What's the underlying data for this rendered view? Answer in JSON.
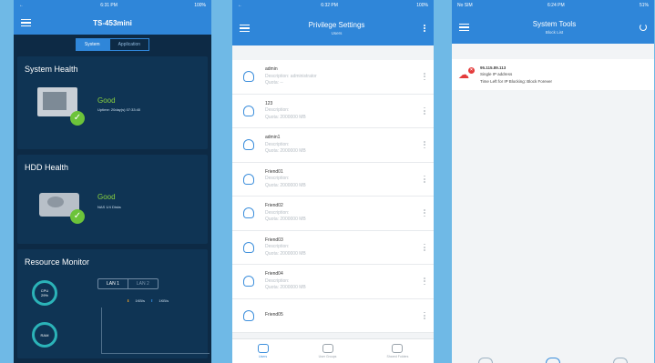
{
  "phone1": {
    "status": {
      "carrier": "",
      "time": "6:31 PM",
      "battery": "100%"
    },
    "title": "TS-453mini",
    "segments": [
      "System",
      "Application"
    ],
    "system_health": {
      "heading": "System Health",
      "status": "Good",
      "uptime": "Uptime: 20day(s) 07:33:40"
    },
    "hdd_health": {
      "heading": "HDD Health",
      "status": "Good",
      "detail": "NAS 1/4 Disks"
    },
    "resource_monitor": {
      "heading": "Resource Monitor",
      "cpu_label": "CPU",
      "cpu_value": "29%",
      "ram_label": "RAM",
      "lan_tabs": [
        "LAN 1",
        "LAN 2"
      ],
      "down_rate": "1KB/s",
      "up_rate": "1KB/s"
    }
  },
  "phone2": {
    "status": {
      "time": "6:32 PM",
      "battery": "100%"
    },
    "title": "Privilege Settings",
    "subtitle": "Users",
    "users": [
      {
        "name": "admin",
        "line1": "Description: administrator",
        "line2": "Quota: --"
      },
      {
        "name": "123",
        "line1": "Description:",
        "line2": "Quota: 2000000 MB"
      },
      {
        "name": "admin1",
        "line1": "Description:",
        "line2": "Quota: 2000000 MB"
      },
      {
        "name": "Friend01",
        "line1": "Description:",
        "line2": "Quota: 2000000 MB"
      },
      {
        "name": "Friend02",
        "line1": "Description:",
        "line2": "Quota: 2000000 MB"
      },
      {
        "name": "Friend03",
        "line1": "Description:",
        "line2": "Quota: 2000000 MB"
      },
      {
        "name": "Friend04",
        "line1": "Description:",
        "line2": "Quota: 2000000 MB"
      },
      {
        "name": "Friend05",
        "line1": "",
        "line2": ""
      }
    ],
    "tabs": [
      "Users",
      "User Groups",
      "Shared Folders"
    ]
  },
  "phone3": {
    "status": {
      "carrier": "No SIM",
      "time": "6:24 PM",
      "battery": "51%"
    },
    "title": "System Tools",
    "subtitle": "Block List",
    "entry": {
      "ip": "95.115.89.113",
      "type": "Single IP address",
      "time_left": "Time Left for IP Blocking: Block Forever"
    }
  },
  "colors": {
    "accent": "#2f86d9",
    "dark_panel": "#0d2a45",
    "good": "#8ad23f",
    "alert": "#e43b3b"
  }
}
